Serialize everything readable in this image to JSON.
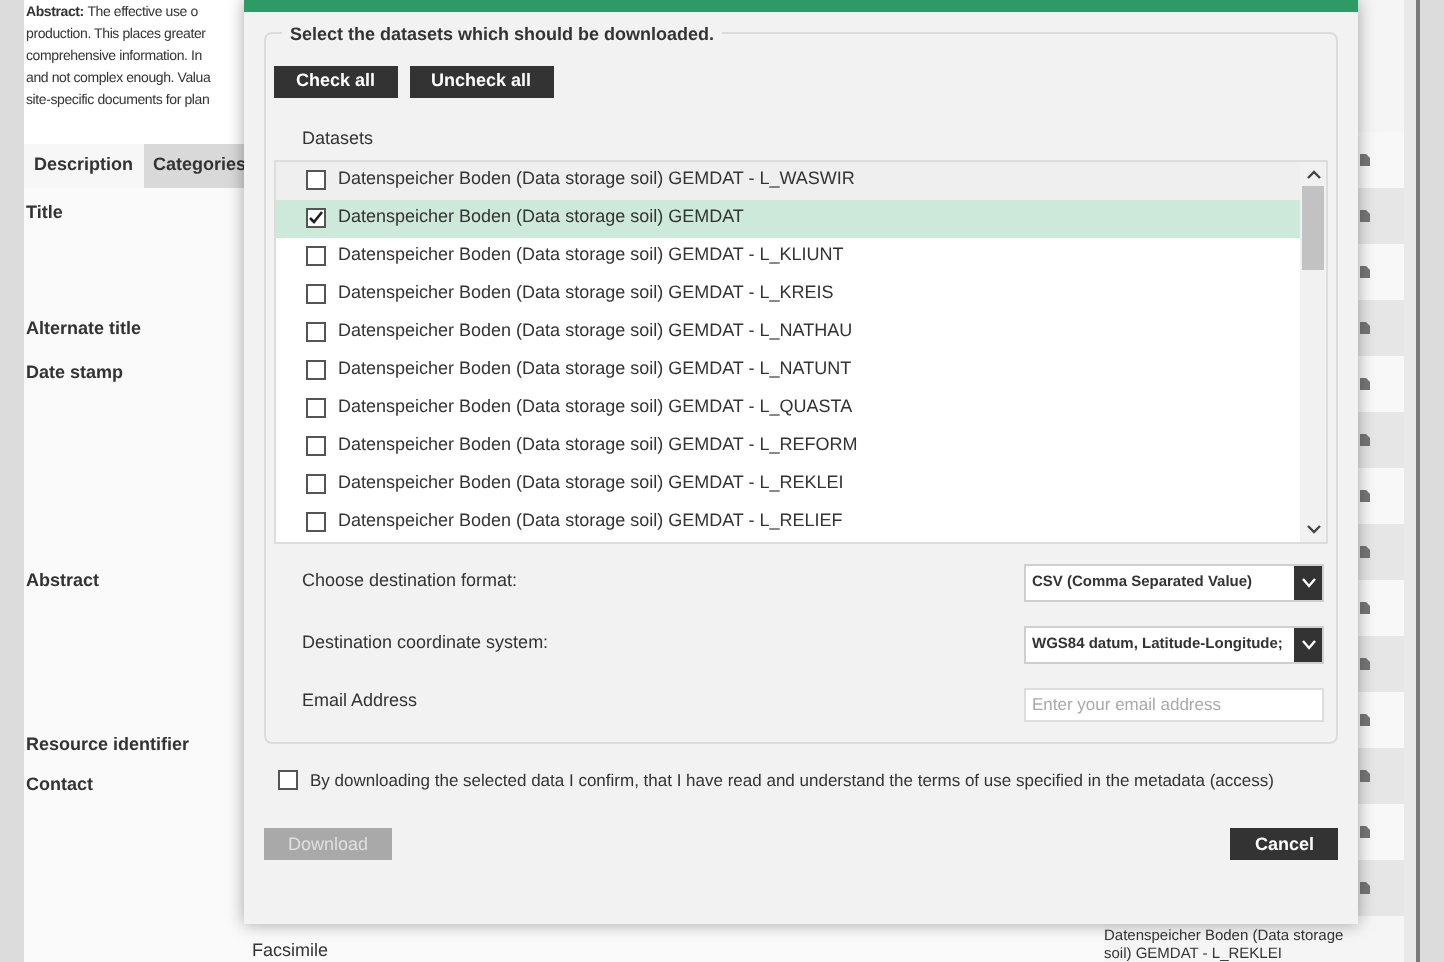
{
  "background": {
    "abstract": {
      "label": "Abstract:",
      "lines": [
        "The effective use o",
        "production. This places greater",
        "comprehensive information. In",
        "and not complex enough. Valua",
        "site-specific documents for plan"
      ]
    },
    "tabs": [
      {
        "label": "Description",
        "selected": true
      },
      {
        "label": "Categories",
        "selected": false
      }
    ],
    "fields": [
      "Title",
      "Alternate title",
      "Date stamp",
      "Abstract",
      "Resource identifier",
      "Contact"
    ],
    "footer_label": "Facsimile",
    "side_item": "Datenspeicher Boden (Data storage soil) GEMDAT - L_REKLEI"
  },
  "dialog": {
    "legend": "Select the datasets which should be downloaded.",
    "buttons": [
      "Check all",
      "Uncheck all"
    ],
    "datasets_label": "Datasets",
    "datasets": [
      {
        "label": "Datenspeicher Boden (Data storage soil) GEMDAT - L_WASWIR",
        "checked": false
      },
      {
        "label": "Datenspeicher Boden (Data storage soil) GEMDAT",
        "checked": true
      },
      {
        "label": "Datenspeicher Boden (Data storage soil) GEMDAT - L_KLIUNT",
        "checked": false
      },
      {
        "label": "Datenspeicher Boden (Data storage soil) GEMDAT - L_KREIS",
        "checked": false
      },
      {
        "label": "Datenspeicher Boden (Data storage soil) GEMDAT - L_NATHAU",
        "checked": false
      },
      {
        "label": "Datenspeicher Boden (Data storage soil) GEMDAT - L_NATUNT",
        "checked": false
      },
      {
        "label": "Datenspeicher Boden (Data storage soil) GEMDAT - L_QUASTA",
        "checked": false
      },
      {
        "label": "Datenspeicher Boden (Data storage soil) GEMDAT - L_REFORM",
        "checked": false
      },
      {
        "label": "Datenspeicher Boden (Data storage soil) GEMDAT - L_REKLEI",
        "checked": false
      },
      {
        "label": "Datenspeicher Boden (Data storage soil) GEMDAT - L_RELIEF",
        "checked": false
      }
    ],
    "format": {
      "label": "Choose destination format:",
      "value": "CSV (Comma Separated Value)"
    },
    "crs": {
      "label": "Destination coordinate system:",
      "value": "WGS84 datum, Latitude-Longitude;"
    },
    "email": {
      "label": "Email Address",
      "placeholder": "Enter your email address"
    },
    "consent": {
      "label": "By downloading the selected data I confirm, that I have read and understand the terms of use specified in the metadata (access)",
      "checked": false
    },
    "download": {
      "label": "Download",
      "disabled": true
    },
    "cancel": "Cancel"
  }
}
